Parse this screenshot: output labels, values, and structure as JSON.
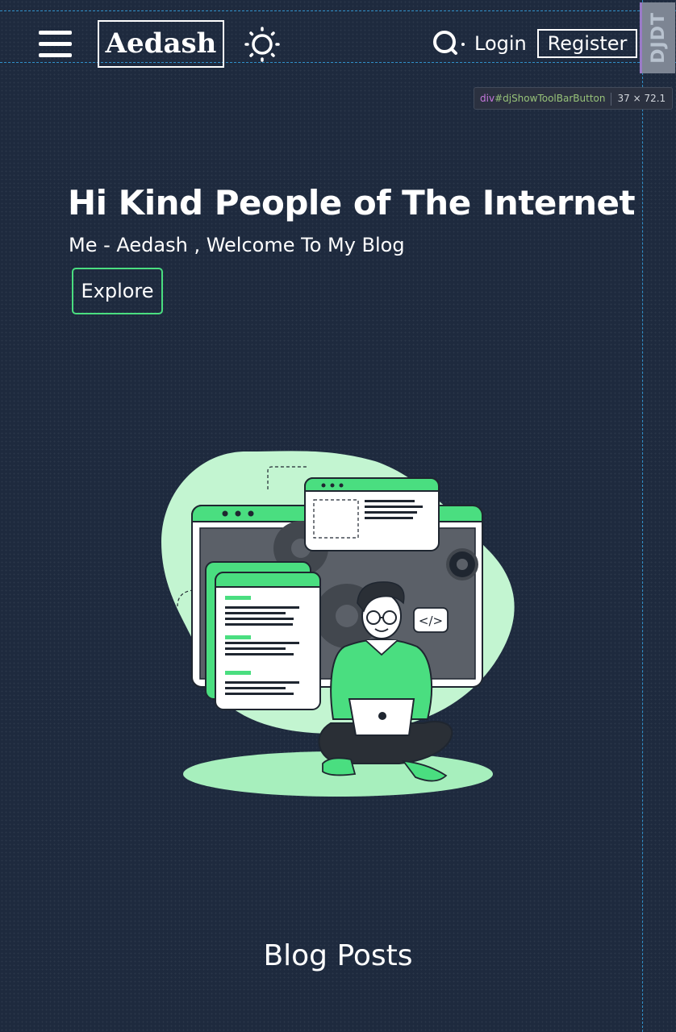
{
  "navbar": {
    "brand": "Aedash",
    "login_label": "Login",
    "register_label": "Register",
    "icons": {
      "menu": "hamburger-menu-icon",
      "theme": "sun-icon",
      "search": "search-icon"
    }
  },
  "debug_toolbar": {
    "handle_label": "DJDT",
    "inspect_tag": "div",
    "inspect_selector": "#djShowToolBarButton",
    "inspect_dimensions": "37 × 72.1"
  },
  "hero": {
    "title": "Hi Kind People of The Internet",
    "subtitle": "Me - Aedash , Welcome To My Blog",
    "explore_label": "Explore",
    "illustration": "developer-with-laptop-illustration",
    "code_tag": "</>"
  },
  "blog": {
    "heading": "Blog Posts"
  },
  "colors": {
    "background": "#1e2a3e",
    "accent": "#4ade80",
    "text": "#ffffff",
    "guide": "#2f8fc8"
  }
}
